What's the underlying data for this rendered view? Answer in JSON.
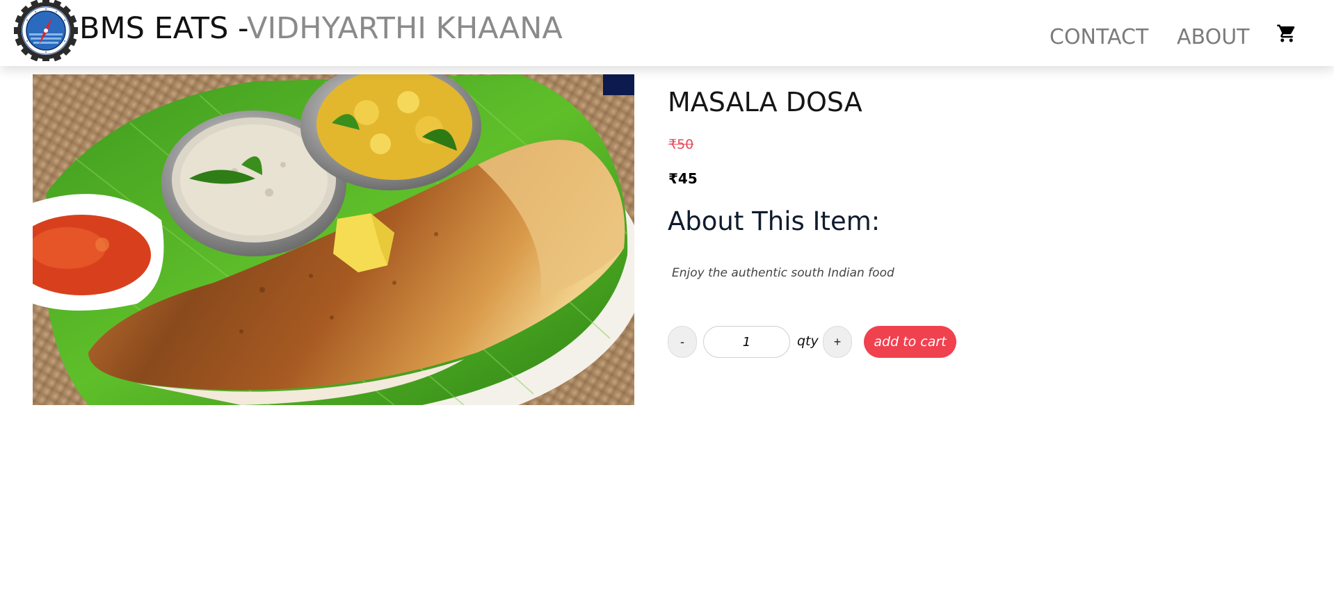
{
  "header": {
    "brand_primary": "BMS EATS -",
    "brand_secondary": "VIDHYARTHI KHAANA",
    "nav": {
      "contact": "CONTACT",
      "about": "ABOUT"
    },
    "logo_icon": "college-emblem",
    "cart_icon": "shopping-cart-icon"
  },
  "product": {
    "name": "MASALA DOSA",
    "old_price": "₹50",
    "price": "₹45",
    "about_heading": "About This Item:",
    "description": "Enjoy the authentic south Indian food",
    "image_subject": "masala dosa with chutneys on banana leaf"
  },
  "purchase": {
    "minus_label": "-",
    "plus_label": "+",
    "quantity": "1",
    "qty_label": "qty",
    "add_to_cart_label": "add to cart"
  },
  "colors": {
    "accent_red": "#f0414f",
    "strike_price": "#e8485a",
    "nav_gray": "#7b7b7b"
  }
}
